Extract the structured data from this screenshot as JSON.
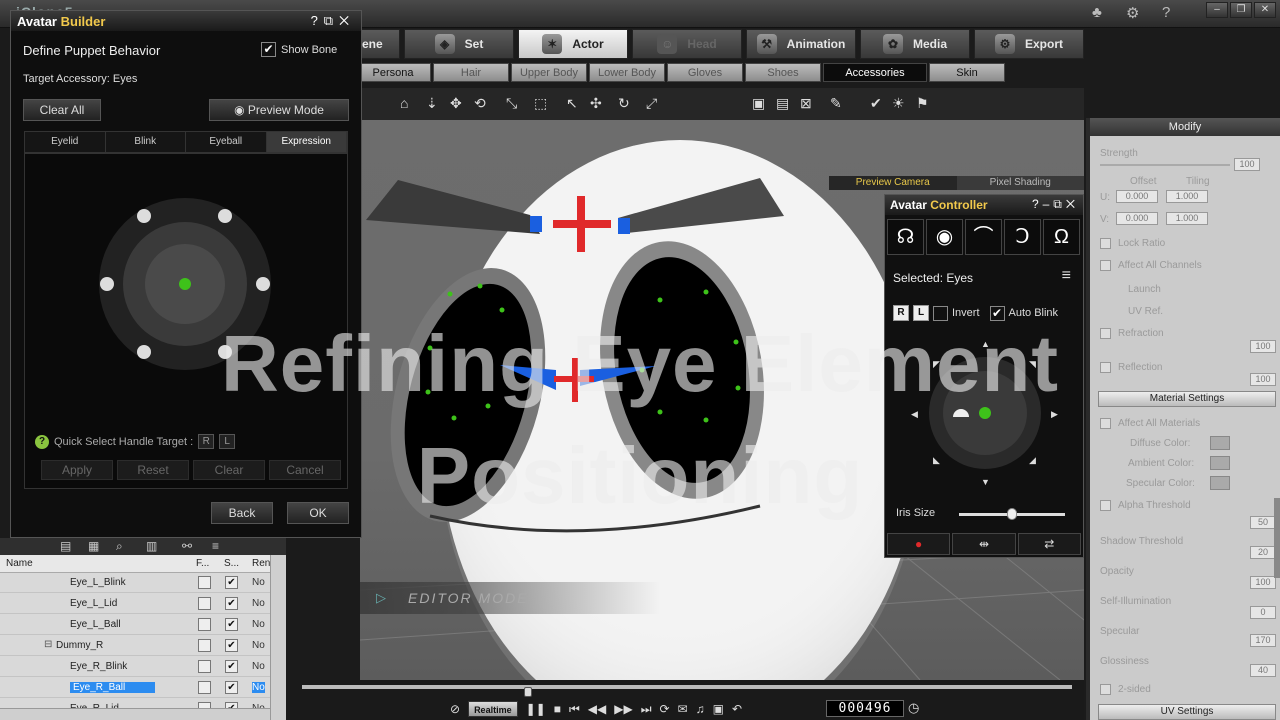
{
  "app": {
    "logo": "iClone5"
  },
  "main_tabs": [
    {
      "label": "Scene",
      "icon": "scene-icon",
      "glyph": "▦"
    },
    {
      "label": "Set",
      "icon": "set-icon",
      "glyph": "◈"
    },
    {
      "label": "Actor",
      "icon": "actor-icon",
      "glyph": "✶"
    },
    {
      "label": "Head",
      "icon": "head-icon",
      "glyph": "☺"
    },
    {
      "label": "Animation",
      "icon": "animation-icon",
      "glyph": "⚒"
    },
    {
      "label": "Media",
      "icon": "media-icon",
      "glyph": "✿"
    },
    {
      "label": "Export",
      "icon": "export-icon",
      "glyph": "⚙"
    }
  ],
  "sub_tabs": [
    "Persona",
    "Hair",
    "Upper Body",
    "Lower Body",
    "Gloves",
    "Shoes",
    "Accessories",
    "Skin"
  ],
  "builder": {
    "title_a": "Avatar ",
    "title_b": "Builder",
    "heading": "Define Puppet Behavior",
    "show_bone": "Show Bone",
    "target": "Target Accessory: Eyes",
    "clear_all": "Clear All",
    "preview_mode": "Preview Mode",
    "tabs": [
      "Eyelid",
      "Blink",
      "Eyeball",
      "Expression"
    ],
    "help": "Quick Select Handle Target :",
    "btn_r": "R",
    "btn_l": "L",
    "actions": [
      "Apply",
      "Reset",
      "Clear",
      "Cancel"
    ],
    "back": "Back",
    "ok": "OK"
  },
  "scene_list": {
    "headers": {
      "name": "Name",
      "f": "F...",
      "s": "S...",
      "render": "Rende"
    },
    "rows": [
      {
        "name": "Eye_L_Blink",
        "s": "✔",
        "render": "No"
      },
      {
        "name": "Eye_L_Lid",
        "s": "✔",
        "render": "No"
      },
      {
        "name": "Eye_L_Ball",
        "s": "✔",
        "render": "No"
      },
      {
        "name": "Dummy_R",
        "s": "✔",
        "render": "No"
      },
      {
        "name": "Eye_R_Blink",
        "s": "✔",
        "render": "No"
      },
      {
        "name": "Eye_R_Ball",
        "s": "✔",
        "render": "No"
      },
      {
        "name": "Eye_R_Lid",
        "s": "✔",
        "render": "No"
      }
    ]
  },
  "viewport": {
    "preview_camera": "Preview Camera",
    "pixel_shading": "Pixel Shading",
    "editor_mode": "EDITOR MODE"
  },
  "controller": {
    "title_a": "Avatar ",
    "title_b": "Controller",
    "selected": "Selected: Eyes",
    "btn_r": "R",
    "btn_l": "L",
    "invert": "Invert",
    "auto_blink": "Auto Blink",
    "iris_size": "Iris Size",
    "iris_value": 0.5
  },
  "modify": {
    "title": "Modify",
    "strength": "Strength",
    "strength_val": "100",
    "offset": "Offset",
    "tiling": "Tiling",
    "u": "U:",
    "v": "V:",
    "u_offset": "0.000",
    "u_tiling": "1.000",
    "v_offset": "0.000",
    "v_tiling": "1.000",
    "lock_ratio": "Lock Ratio",
    "affect_all": "Affect All Channels",
    "launch": "Launch",
    "uv_ref": "UV Ref.",
    "refraction": "Refraction",
    "refraction_val": "100",
    "reflection": "Reflection",
    "reflection_val": "100",
    "material_settings": "Material Settings",
    "affect_all_materials": "Affect All Materials",
    "diffuse": "Diffuse Color:",
    "ambient": "Ambient Color:",
    "specular_color": "Specular Color:",
    "alpha_threshold": "Alpha Threshold",
    "alpha_val": "50",
    "shadow_threshold": "Shadow Threshold",
    "shadow_val": "20",
    "opacity": "Opacity",
    "opacity_val": "100",
    "self_illum": "Self-Illumination",
    "self_illum_val": "0",
    "specular": "Specular",
    "specular_val": "170",
    "glossiness": "Glossiness",
    "glossiness_val": "40",
    "two_sided": "2-sided",
    "uv_settings": "UV Settings"
  },
  "transport": {
    "realtime": "Realtime",
    "frame": "000496",
    "position": 0.288
  },
  "overlay": {
    "line1": "Refining Eye Element",
    "line2": "Positioning"
  },
  "colors": {
    "accent_yellow": "#f2c94c",
    "handle_green": "#3ec21a",
    "bone_blue": "#1a5fe0",
    "bone_red": "#e0292a",
    "selection_blue": "#2c8cf0"
  }
}
